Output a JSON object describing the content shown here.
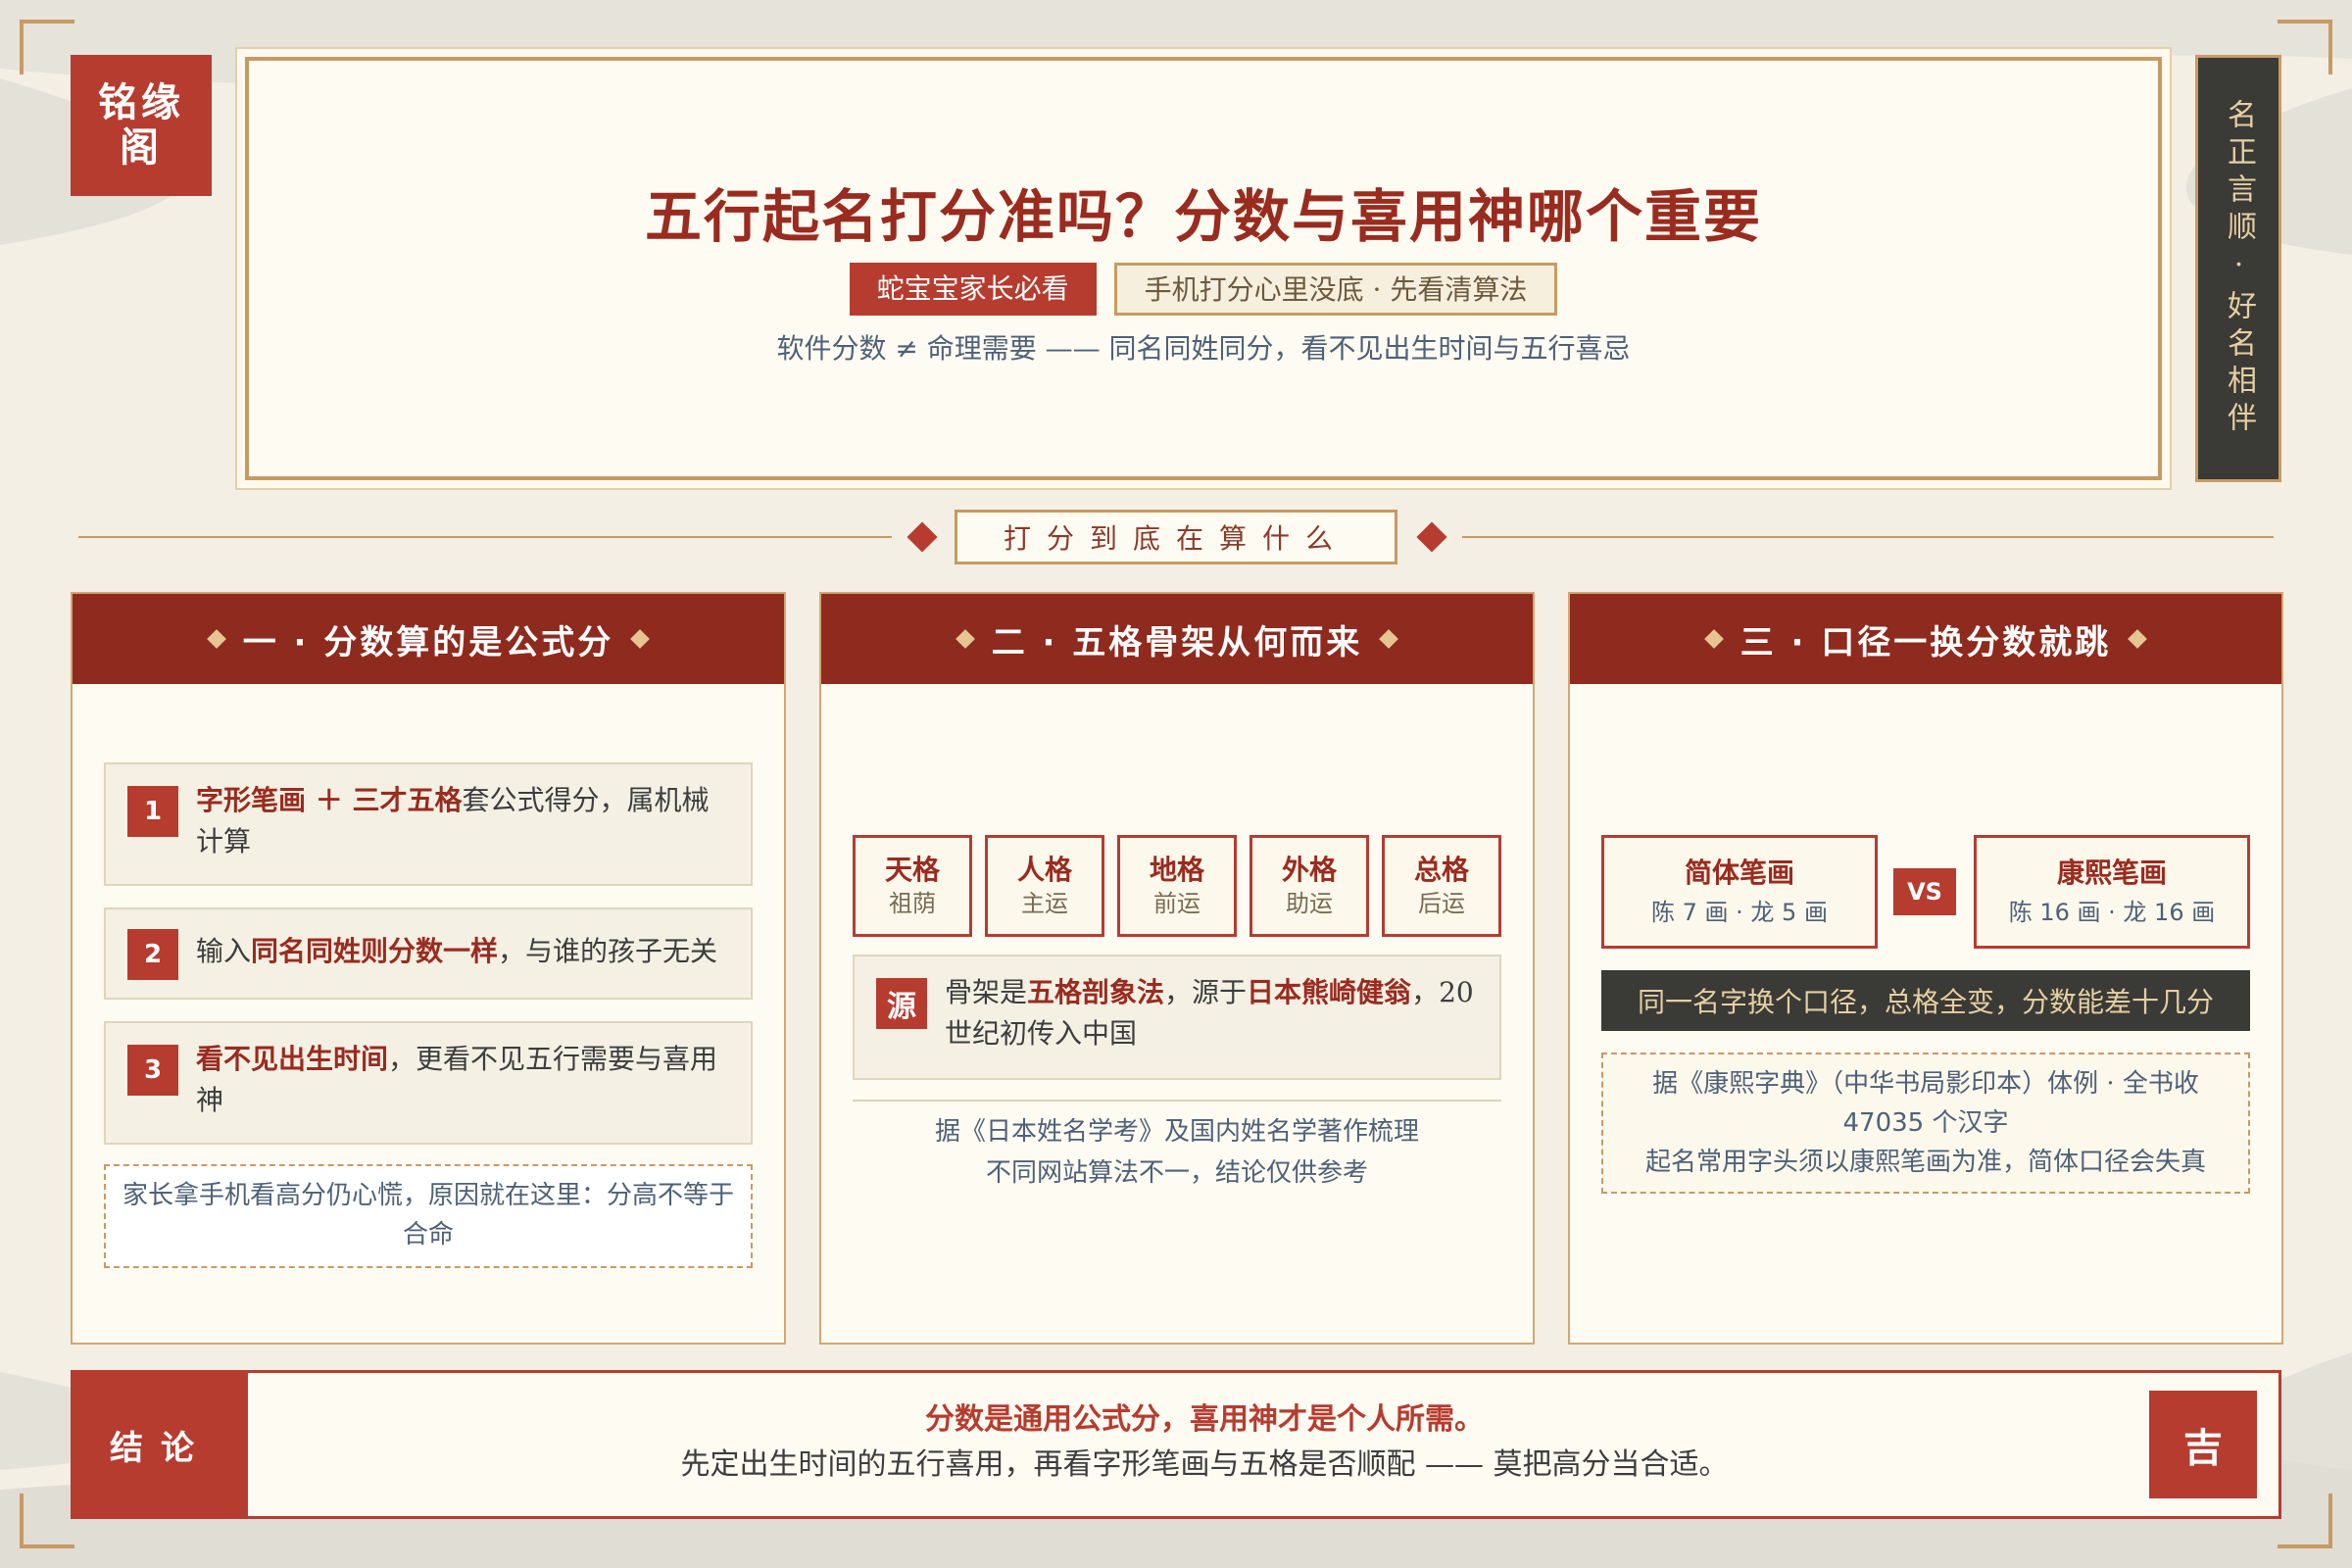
{
  "logo": {
    "text": "铭缘阁"
  },
  "motto": {
    "text": "名正言顺·好名相伴"
  },
  "header": {
    "title": "五行起名打分准吗？分数与喜用神哪个重要",
    "tag_primary": "蛇宝宝家长必看",
    "tag_secondary": "手机打分心里没底 · 先看清算法",
    "subtitle": "软件分数 ≠ 命理需要 —— 同名同姓同分，看不见出生时间与五行喜忌"
  },
  "section": {
    "title": "打分到底在算什么"
  },
  "columns": [
    {
      "heading": "一 · 分数算的是公式分",
      "items": [
        {
          "num": "1",
          "hl1": "字形笔画 ＋ 三才五格",
          "rest": "套公式得分，属机械计算"
        },
        {
          "num": "2",
          "pre": "输入",
          "hl1": "同名同姓则分数一样",
          "rest": "，与谁的孩子无关"
        },
        {
          "num": "3",
          "hl1": "看不见出生时间",
          "rest": "，更看不见五行需要与喜用神"
        }
      ],
      "note": "家长拿手机看高分仍心慌，原因就在这里：分高不等于合命"
    },
    {
      "heading": "二 · 五格骨架从何而来",
      "ge": [
        {
          "name": "天格",
          "sub": "祖荫"
        },
        {
          "name": "人格",
          "sub": "主运"
        },
        {
          "name": "地格",
          "sub": "前运"
        },
        {
          "name": "外格",
          "sub": "助运"
        },
        {
          "name": "总格",
          "sub": "后运"
        }
      ],
      "source": {
        "icon": "源",
        "pre": "骨架是",
        "hl1": "五格剖象法",
        "mid": "，源于",
        "hl2": "日本熊崎健翁",
        "rest": "，20世纪初传入中国"
      },
      "ref_line1": "据《日本姓名学考》及国内姓名学著作梳理",
      "ref_line2": "不同网站算法不一，结论仅供参考"
    },
    {
      "heading": "三 · 口径一换分数就跳",
      "left": {
        "title": "简体笔画",
        "value": "陈 7 画 · 龙 5 画"
      },
      "vs": "VS",
      "right": {
        "title": "康熙笔画",
        "value": "陈 16 画 · 龙 16 画"
      },
      "bar": "同一名字换个口径，总格全变，分数能差十几分",
      "dict_line1": "据《康熙字典》（中华书局影印本）体例 · 全书收",
      "dict_line2": "47035 个汉字",
      "dict_line3": "起名常用字头须以康熙笔画为准，简体口径会失真"
    }
  ],
  "conclusion": {
    "label": "结论",
    "main": "分数是通用公式分，喜用神才是个人所需。",
    "sub": "先定出生时间的五行喜用，再看字形笔画与五格是否顺配 —— 莫把高分当合适。",
    "seal": "吉"
  },
  "colors": {
    "accent": "#b63c2f",
    "dark_red": "#8f2a1e",
    "gold": "#c89a62",
    "ink": "#3a3a36"
  }
}
